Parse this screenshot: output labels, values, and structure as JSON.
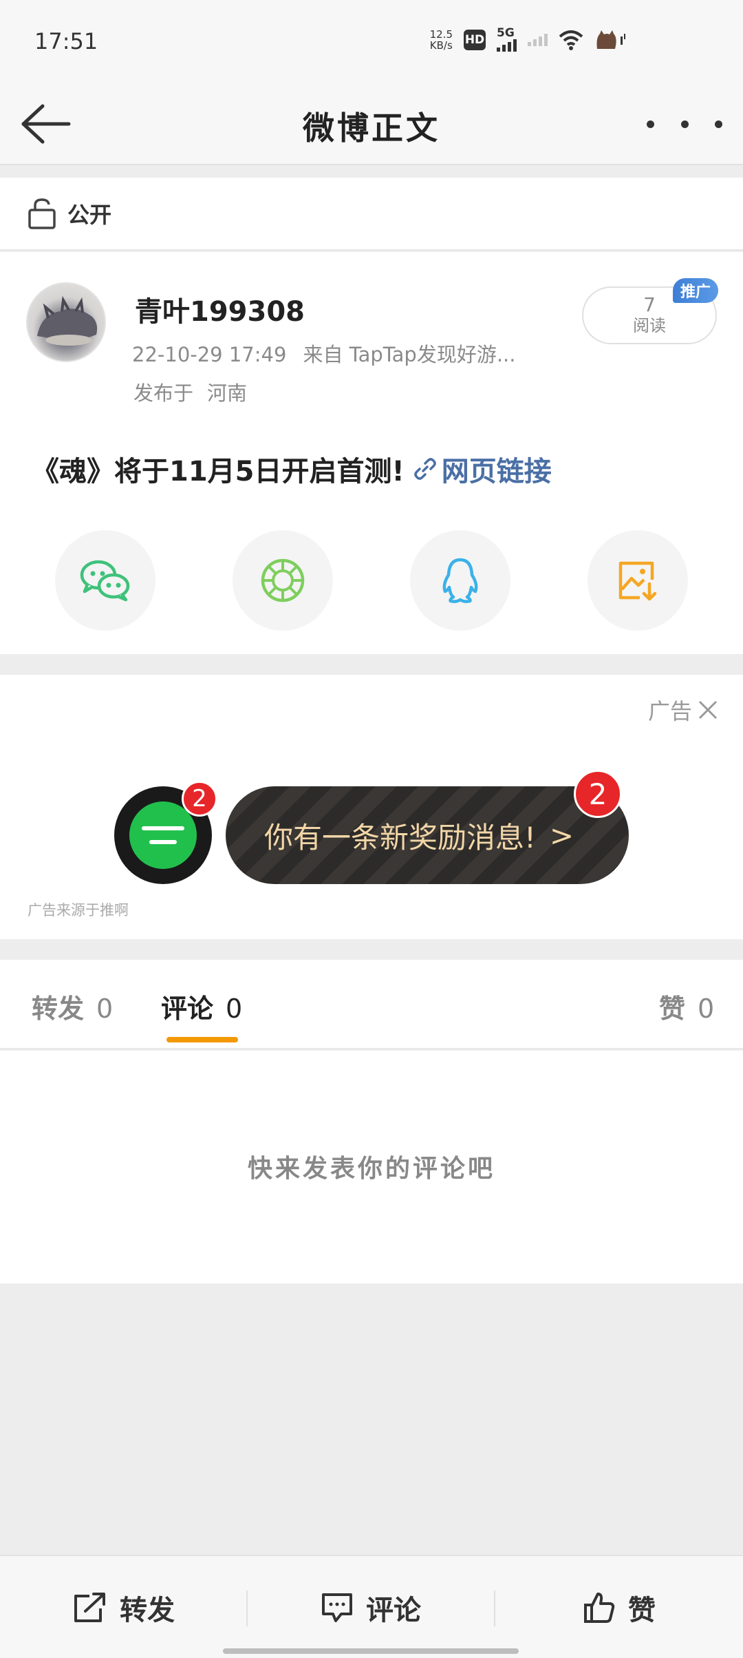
{
  "status_bar": {
    "time": "17:51",
    "net_speed_value": "12.5",
    "net_speed_unit": "KB/s",
    "hd_label": "HD",
    "network_label": "5G"
  },
  "nav": {
    "title": "微博正文",
    "back_icon": "back-arrow-icon",
    "more_icon": "more-dots-icon"
  },
  "visibility": {
    "label": "公开",
    "icon": "unlock-icon"
  },
  "post": {
    "username": "青叶199308",
    "date_time": "22-10-29 17:49",
    "source": "来自 TapTap发现好游...",
    "location_prefix": "发布于",
    "location": "河南",
    "read_count": "7",
    "read_label": "阅读",
    "promo_badge": "推广",
    "text": "《魂》将于11月5日开启首测!",
    "link_label": "网页链接"
  },
  "share": {
    "items": [
      {
        "icon": "wechat-icon",
        "color": "#3ec27a"
      },
      {
        "icon": "moments-icon",
        "color": "#7fce5e"
      },
      {
        "icon": "qq-icon",
        "color": "#3ab1e8"
      },
      {
        "icon": "save-image-icon",
        "color": "#f5a623"
      }
    ]
  },
  "ad": {
    "tag": "广告",
    "badge_count": "2",
    "message": "你有一条新奖励消息!",
    "arrow": ">",
    "source": "广告来源于推啊"
  },
  "tabs": [
    {
      "label": "转发",
      "count": "0"
    },
    {
      "label": "评论",
      "count": "0"
    },
    {
      "label": "赞",
      "count": "0"
    }
  ],
  "comments": {
    "empty_hint": "快来发表你的评论吧"
  },
  "bottom_bar": {
    "repost": "转发",
    "comment": "评论",
    "like": "赞"
  },
  "colors": {
    "accent_orange": "#f39800",
    "link_blue": "#4a6fa5",
    "badge_blue": "#3d7fd6",
    "ad_red": "#e7262a",
    "ad_green": "#21c04d"
  }
}
